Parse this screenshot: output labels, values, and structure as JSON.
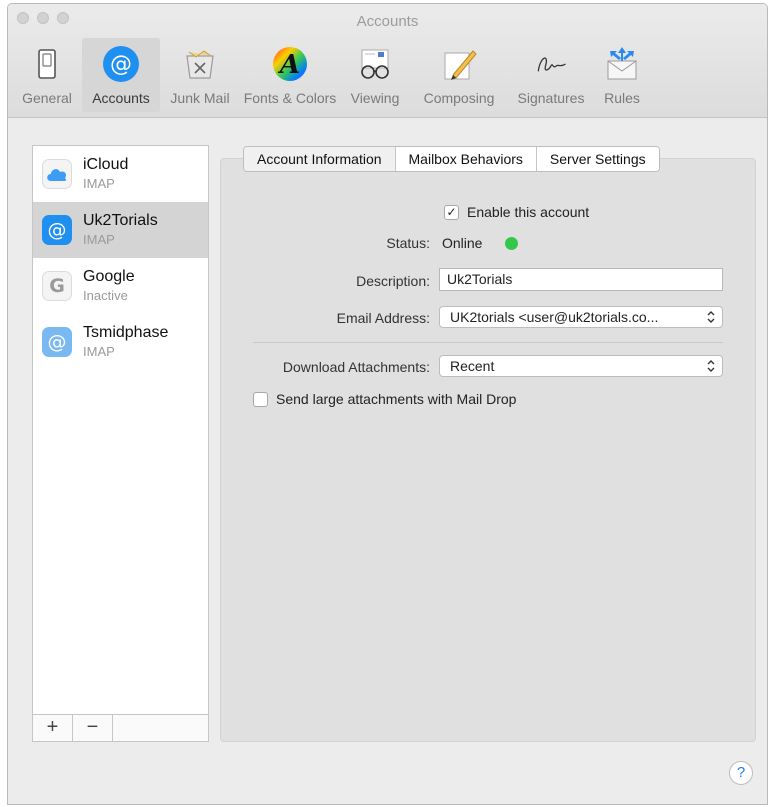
{
  "window": {
    "title": "Accounts"
  },
  "toolbar": {
    "items": [
      {
        "label": "General",
        "icon": "general-switch-icon"
      },
      {
        "label": "Accounts",
        "icon": "at-sign-icon",
        "active": true
      },
      {
        "label": "Junk Mail",
        "icon": "junk-tray-icon"
      },
      {
        "label": "Fonts & Colors",
        "icon": "font-color-wheel-icon"
      },
      {
        "label": "Viewing",
        "icon": "glasses-icon"
      },
      {
        "label": "Composing",
        "icon": "pencil-icon"
      },
      {
        "label": "Signatures",
        "icon": "signature-icon"
      },
      {
        "label": "Rules",
        "icon": "envelope-arrows-icon"
      }
    ]
  },
  "accounts": [
    {
      "name": "iCloud",
      "type": "IMAP",
      "icon": "cloud-icon"
    },
    {
      "name": "Uk2Torials",
      "type": "IMAP",
      "icon": "at-sign-icon",
      "selected": true
    },
    {
      "name": "Google",
      "type": "Inactive",
      "icon": "google-g-icon"
    },
    {
      "name": "Tsmidphase",
      "type": "IMAP",
      "icon": "at-sign-icon"
    }
  ],
  "sidebar_footer": {
    "add": "+",
    "remove": "−"
  },
  "tabs": [
    {
      "label": "Account Information",
      "active": true
    },
    {
      "label": "Mailbox Behaviors"
    },
    {
      "label": "Server Settings"
    }
  ],
  "form": {
    "enable_label": "Enable this account",
    "enable_checked": "✓",
    "status_label": "Status:",
    "status_value": "Online",
    "description_label": "Description:",
    "description_value": "Uk2Torials",
    "email_label": "Email Address:",
    "email_value": "UK2torials <user@uk2torials.co...",
    "download_label": "Download Attachments:",
    "download_value": "Recent",
    "maildrop_label": "Send large attachments with Mail Drop"
  },
  "help": {
    "label": "?"
  },
  "colors": {
    "status_online": "#34c84a",
    "accent": "#1a7cf0"
  }
}
